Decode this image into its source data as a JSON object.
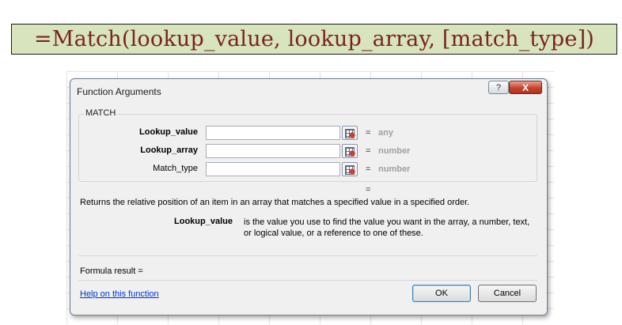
{
  "banner": {
    "formula": "=Match(lookup_value, lookup_array, [match_type])"
  },
  "dialog": {
    "title": "Function Arguments",
    "help_glyph": "?",
    "close_glyph": "X",
    "function_name": "MATCH",
    "arguments": [
      {
        "label": "Lookup_value",
        "value": "",
        "equals": "=",
        "type_hint": "any"
      },
      {
        "label": "Lookup_array",
        "value": "",
        "equals": "=",
        "type_hint": "number"
      },
      {
        "label": "Match_type",
        "value": "",
        "equals": "=",
        "type_hint": "number"
      }
    ],
    "result_equals": "=",
    "description": "Returns the relative position of an item in an array that matches a specified value in a specified order.",
    "arg_description": {
      "name": "Lookup_value",
      "text": "is the value you use to find the value you want in the array, a number, text, or logical value, or a reference to one of these."
    },
    "formula_result_label": "Formula result =",
    "help_link": "Help on this function",
    "ok_label": "OK",
    "cancel_label": "Cancel"
  }
}
